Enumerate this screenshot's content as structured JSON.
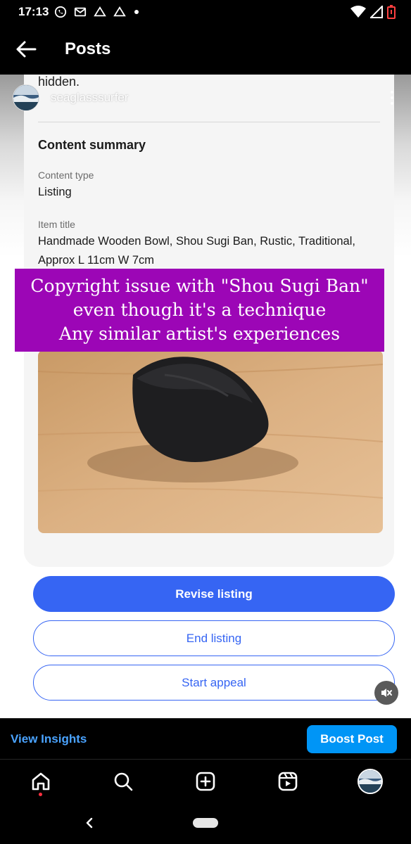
{
  "status_bar": {
    "time": "17:13"
  },
  "header": {
    "title": "Posts"
  },
  "post": {
    "partial_text": "hidden.",
    "username": "seaglasssurfer",
    "overlay_text": [
      "Copyright issue with \"Shou Sugi Ban\"",
      "even though it's a technique",
      "Any similar artist's experiences"
    ]
  },
  "summary": {
    "title": "Content summary",
    "content_type_label": "Content type",
    "content_type_value": "Listing",
    "item_title_label": "Item title",
    "item_title_value": "Handmade Wooden Bowl, Shou Sugi Ban, Rustic, Traditional, Approx L 11cm W 7cm"
  },
  "actions": {
    "revise": "Revise listing",
    "end": "End listing",
    "appeal": "Start appeal"
  },
  "insights": {
    "view_insights": "View Insights",
    "boost_post": "Boost Post"
  },
  "colors": {
    "accent": "#3665f3",
    "banner": "#9c06b6",
    "boost": "#0095f6",
    "insights_link": "#4aa3ff"
  }
}
